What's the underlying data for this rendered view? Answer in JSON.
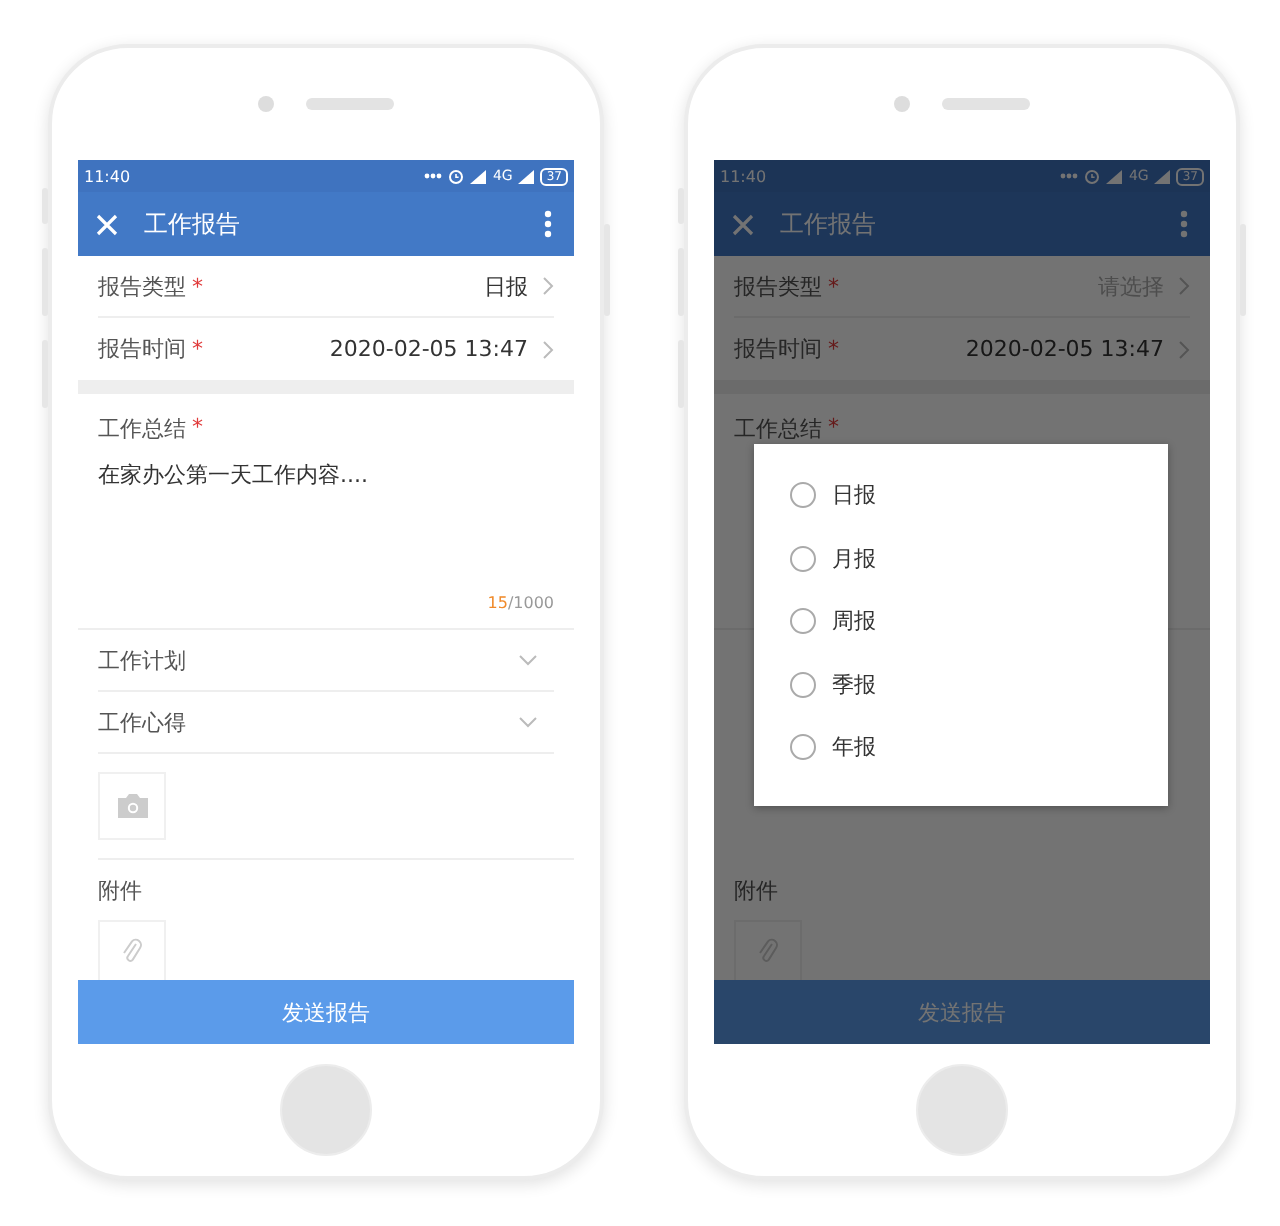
{
  "phones": [
    {
      "status_bar": {
        "time": "11:40",
        "network": "4G",
        "battery": "37"
      },
      "header": {
        "title": "工作报告"
      },
      "fields": [
        {
          "label": "报告类型",
          "required_mark": "*",
          "value": "日报"
        },
        {
          "label": "报告时间",
          "required_mark": "*",
          "value": "2020-02-05 13:47"
        }
      ],
      "summary": {
        "label": "工作总结",
        "required_mark": "*",
        "text": "在家办公第一天工作内容....",
        "count": "15",
        "limit": "/1000"
      },
      "sections": [
        {
          "label": "工作计划",
          "expanded": false
        },
        {
          "label": "工作心得",
          "expanded": false
        }
      ],
      "photo_upload": true,
      "attachments": {
        "label": "附件"
      },
      "submit": "发送报告"
    },
    {
      "status_bar": {
        "time": "11:40",
        "network": "4G",
        "battery": "37"
      },
      "header": {
        "title": "工作报告"
      },
      "fields": [
        {
          "label": "报告类型",
          "required_mark": "*",
          "placeholder": "请选择"
        },
        {
          "label": "报告时间",
          "required_mark": "*",
          "value": "2020-02-05 13:47"
        }
      ],
      "summary": {
        "label": "工作总结",
        "required_mark": "*"
      },
      "attachments": {
        "label": "附件"
      },
      "submit": "发送报告",
      "dialog": {
        "options": [
          {
            "label": "日报",
            "selected": false
          },
          {
            "label": "月报",
            "selected": false
          },
          {
            "label": "周报",
            "selected": false
          },
          {
            "label": "季报",
            "selected": false
          },
          {
            "label": "年报",
            "selected": false
          }
        ]
      }
    }
  ]
}
